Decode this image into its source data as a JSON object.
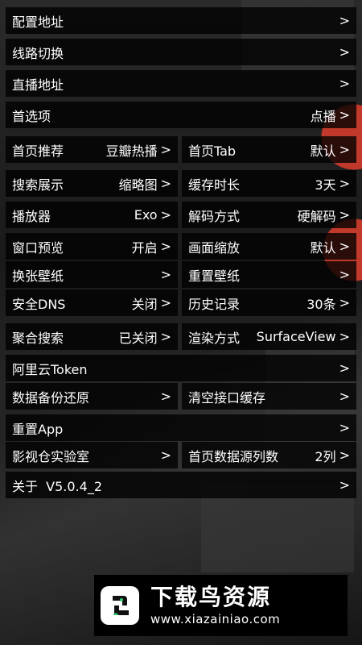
{
  "settings": {
    "config_address": {
      "label": "配置地址",
      "chevron": ">"
    },
    "route_switch": {
      "label": "线路切换",
      "chevron": ">"
    },
    "live_address": {
      "label": "直播地址",
      "chevron": ">"
    },
    "preferences": {
      "label": "首选项",
      "value": "点播",
      "chevron": ">"
    },
    "home_recommend": {
      "label": "首页推荐",
      "value": "豆瓣热播",
      "chevron": ">"
    },
    "home_tab": {
      "label": "首页Tab",
      "value": "默认",
      "chevron": ">"
    },
    "search_display": {
      "label": "搜索展示",
      "value": "缩略图",
      "chevron": ">"
    },
    "cache_duration": {
      "label": "缓存时长",
      "value": "3天",
      "chevron": ">"
    },
    "player": {
      "label": "播放器",
      "value": "Exo",
      "chevron": ">"
    },
    "decode_mode": {
      "label": "解码方式",
      "value": "硬解码",
      "chevron": ">"
    },
    "window_preview": {
      "label": "窗口预览",
      "value": "开启",
      "chevron": ">"
    },
    "picture_scale": {
      "label": "画面缩放",
      "value": "默认",
      "chevron": ">"
    },
    "change_wallpaper": {
      "label": "换张壁纸",
      "chevron": ">"
    },
    "reset_wallpaper": {
      "label": "重置壁纸",
      "chevron": ">"
    },
    "secure_dns": {
      "label": "安全DNS",
      "value": "关闭",
      "chevron": ">"
    },
    "history": {
      "label": "历史记录",
      "value": "30条",
      "chevron": ">"
    },
    "aggregate_search": {
      "label": "聚合搜索",
      "value": "已关闭",
      "chevron": ">"
    },
    "render_mode": {
      "label": "渲染方式",
      "value": "SurfaceView",
      "chevron": ">"
    },
    "aliyun_token": {
      "label": "阿里云Token",
      "chevron": ">"
    },
    "data_backup": {
      "label": "数据备份还原",
      "chevron": ">"
    },
    "clear_cache": {
      "label": "清空接口缓存",
      "chevron": ">"
    },
    "reset_app": {
      "label": "重置App",
      "chevron": ">"
    },
    "lab": {
      "label": "影视仓实验室",
      "chevron": ">"
    },
    "home_columns": {
      "label": "首页数据源列数",
      "value": "2列",
      "chevron": ">"
    },
    "about": {
      "label": "关于  V5.0.4_2",
      "chevron": ">"
    }
  },
  "watermark": {
    "title": "下载鸟资源",
    "url": "www.xiazainiao.com",
    "icon": "bird-logo-icon"
  },
  "colors": {
    "background": "#141414",
    "row_bg": "#000000",
    "text": "#ffffff",
    "accent_red": "#c0392b"
  }
}
